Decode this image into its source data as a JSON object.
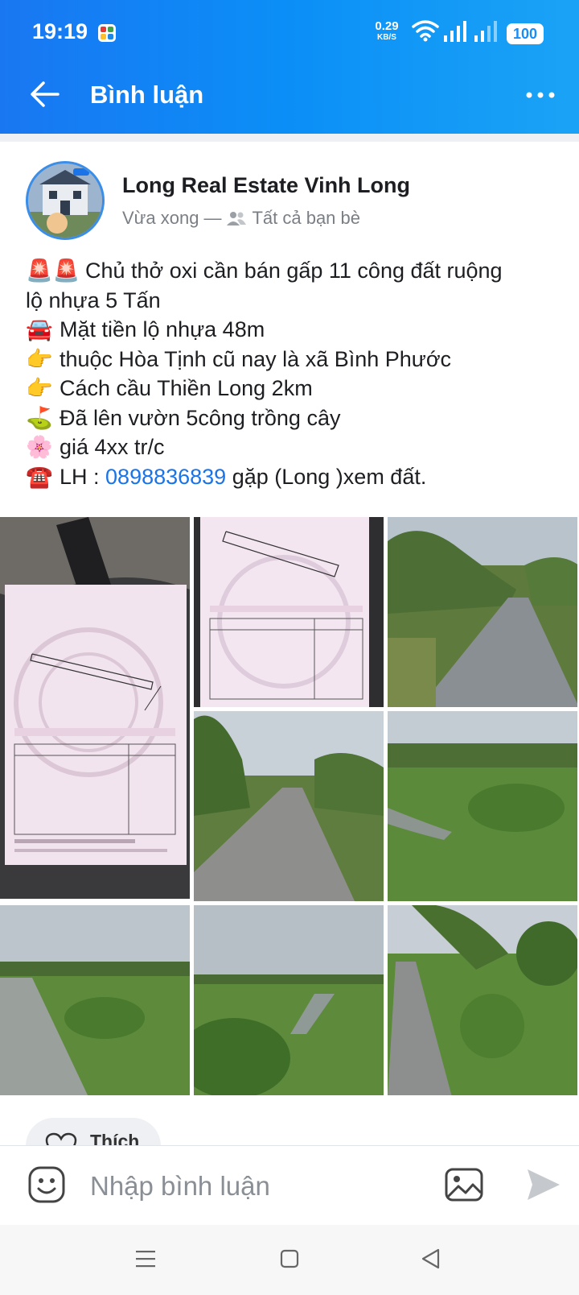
{
  "status_bar": {
    "time": "19:19",
    "net_speed_value": "0.29",
    "net_speed_unit": "KB/S",
    "battery": "100"
  },
  "header": {
    "title": "Bình luận",
    "back_icon": "arrow-left-icon",
    "more_icon": "more-dots-icon"
  },
  "post": {
    "author": "Long Real Estate Vinh Long",
    "time": "Vừa xong",
    "separator": "—",
    "privacy": "Tất cả bạn bè",
    "lines": [
      {
        "emoji": "🚨🚨",
        "text": "Chủ thở oxi cần bán gấp 11 công đất ruộng"
      },
      {
        "emoji": "",
        "text": "lộ nhựa 5 Tấn"
      },
      {
        "emoji": "🚘",
        "text": "Mặt tiền lộ nhựa 48m"
      },
      {
        "emoji": "👉",
        "text": "thuộc Hòa Tịnh cũ nay là xã Bình Phước"
      },
      {
        "emoji": "👉",
        "text": "Cách cầu Thiền Long 2km"
      },
      {
        "emoji": "⛳",
        "text": "Đã lên vườn 5công trồng cây"
      },
      {
        "emoji": "🌸",
        "text": "giá 4xx tr/c"
      }
    ],
    "contact": {
      "emoji": "☎️",
      "prefix": "LH : ",
      "phone": "0898836839",
      "suffix": " gặp (Long )xem đất."
    },
    "photos": [
      "land-certificate-photo",
      "land-certificate-photo",
      "rural-road-banana-trees-photo",
      "rural-road-photo",
      "overgrown-field-canal-photo",
      "flooded-canal-photo",
      "garden-canal-photo",
      "roadside-garden-photo"
    ]
  },
  "actions": {
    "like_label": "Thích",
    "like_icon": "heart-icon"
  },
  "composer": {
    "placeholder": "Nhập bình luận",
    "emoji_icon": "emoji-icon",
    "image_icon": "image-icon",
    "send_icon": "send-icon"
  },
  "colors": {
    "header_gradient_start": "#1977f2",
    "header_gradient_end": "#1aa3f6",
    "link": "#1a74e8"
  }
}
